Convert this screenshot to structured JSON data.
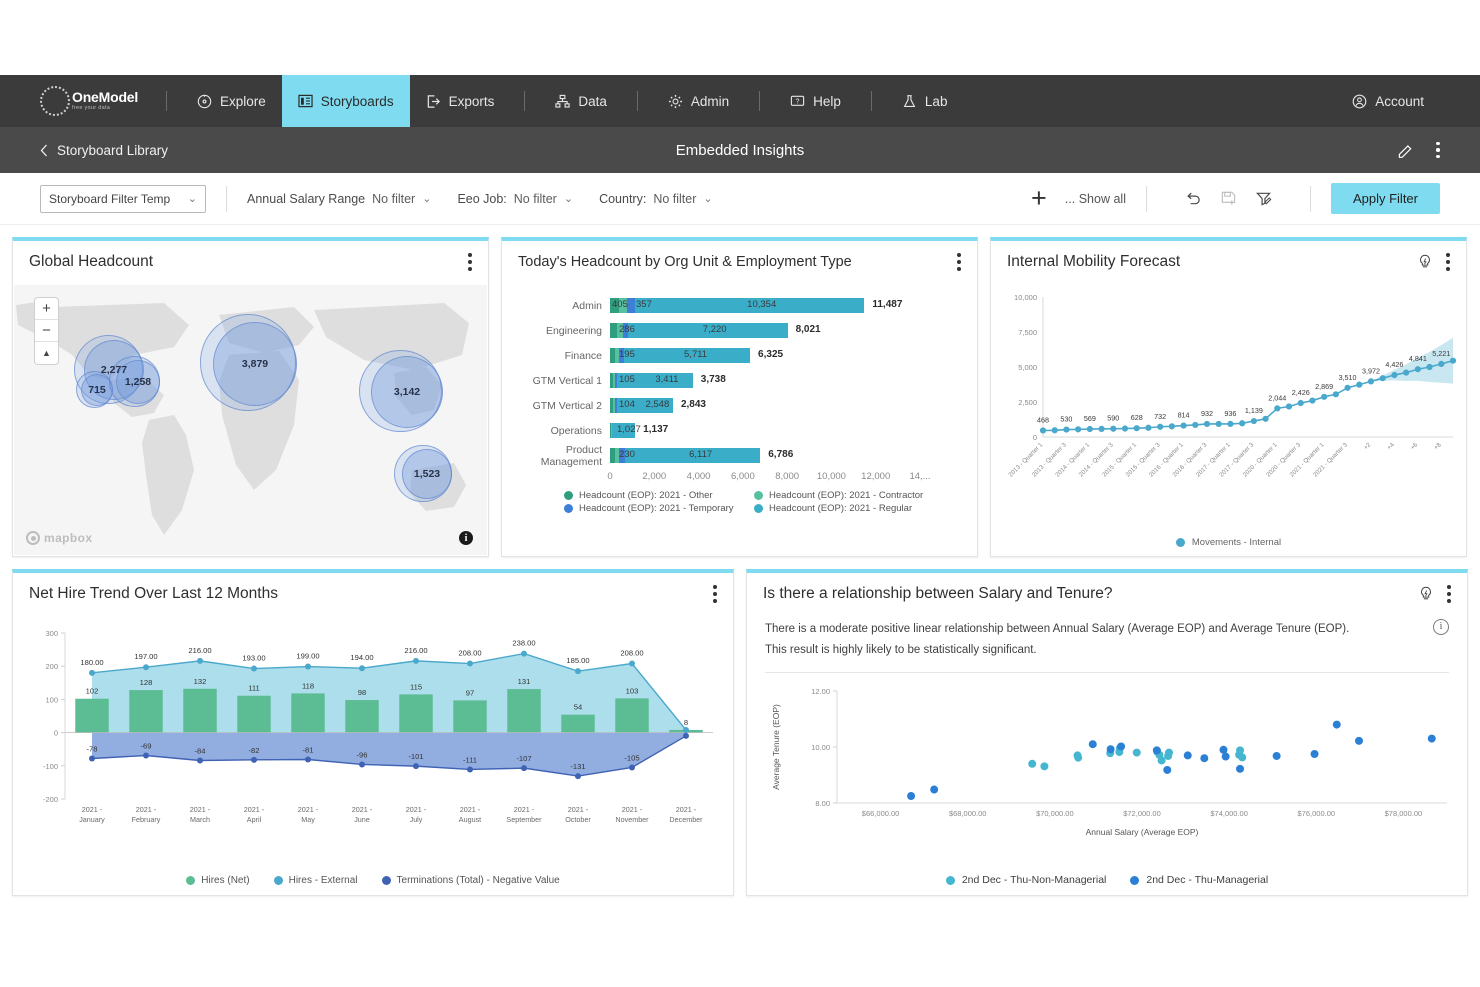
{
  "nav": {
    "logo_name": "OneModel",
    "logo_tagline": "free your data",
    "items": [
      {
        "label": "Explore",
        "icon": "compass-icon",
        "active": false
      },
      {
        "label": "Storyboards",
        "icon": "storyboard-icon",
        "active": true
      },
      {
        "label": "Exports",
        "icon": "export-icon",
        "active": false
      },
      {
        "label": "Data",
        "icon": "data-icon",
        "active": false
      },
      {
        "label": "Admin",
        "icon": "gear-icon",
        "active": false
      },
      {
        "label": "Help",
        "icon": "help-icon",
        "active": false
      },
      {
        "label": "Lab",
        "icon": "flask-icon",
        "active": false
      }
    ],
    "account_label": "Account",
    "active_color": "#7fdbf0"
  },
  "subheader": {
    "back_label": "Storyboard Library",
    "title": "Embedded Insights",
    "edit_icon": "pencil-icon",
    "more_icon": "kebab-menu-icon"
  },
  "filterbar": {
    "template_value": "Storyboard Filter Temp",
    "filters": [
      {
        "name": "Annual Salary Range",
        "value": "No filter"
      },
      {
        "name": "Eeo Job:",
        "value": "No filter"
      },
      {
        "name": "Country:",
        "value": "No filter"
      }
    ],
    "add_icon": "plus-icon",
    "show_all_label": "... Show all",
    "reset_icon": "undo-icon",
    "save_icon": "save-icon",
    "edit_filter_icon": "filter-edit-icon",
    "apply_label": "Apply Filter"
  },
  "panels": {
    "map": {
      "title": "Global Headcount",
      "more_icon": "kebab-menu-icon",
      "attribution": "mapbox",
      "zoom_in": "+",
      "zoom_out": "−",
      "compass": "compass-icon",
      "info_icon": "info-icon"
    },
    "bar": {
      "title": "Today's Headcount by Org Unit & Employment Type",
      "more_icon": "kebab-menu-icon"
    },
    "mobility": {
      "title": "Internal Mobility Forecast",
      "insight_icon": "lightbulb-icon",
      "more_icon": "kebab-menu-icon"
    },
    "net": {
      "title": "Net Hire Trend Over Last 12 Months",
      "more_icon": "kebab-menu-icon"
    },
    "scatter": {
      "title": "Is there a relationship between Salary and Tenure?",
      "insight_icon": "lightbulb-icon",
      "more_icon": "kebab-menu-icon",
      "info_icon": "info-icon",
      "insight_line1": "There is a moderate positive linear relationship between Annual Salary (Average EOP) and Average Tenure (EOP).",
      "insight_line2": "This result is highly likely to be statistically significant."
    }
  },
  "chart_data": [
    {
      "id": "global_headcount_map",
      "type": "scatter",
      "title": "Global Headcount",
      "bubbles": [
        {
          "label": "2,277",
          "value": 2277,
          "cx": 100,
          "cy": 85,
          "r": 30
        },
        {
          "label": "715",
          "value": 715,
          "cx": 83,
          "cy": 105,
          "r": 16
        },
        {
          "label": "1,258",
          "value": 1258,
          "cx": 124,
          "cy": 97,
          "r": 22
        },
        {
          "label": "3,879",
          "value": 3879,
          "cx": 241,
          "cy": 79,
          "r": 42
        },
        {
          "label": "3,142",
          "value": 3142,
          "cx": 393,
          "cy": 107,
          "r": 36
        },
        {
          "label": "1,523",
          "value": 1523,
          "cx": 413,
          "cy": 189,
          "r": 25
        }
      ]
    },
    {
      "id": "headcount_by_org_unit",
      "type": "bar",
      "orientation": "horizontal",
      "stacked": true,
      "title": "Today's Headcount by Org Unit & Employment Type",
      "categories": [
        "Admin",
        "Engineering",
        "Finance",
        "GTM Vertical 1",
        "GTM Vertical 2",
        "Operations",
        "Product Management"
      ],
      "series": [
        {
          "name": "Headcount (EOP): 2021 - Other",
          "color": "#2e9e7e",
          "values": [
            405,
            300,
            220,
            120,
            120,
            60,
            230
          ]
        },
        {
          "name": "Headcount (EOP): 2021 - Contractor",
          "color": "#56c0a0",
          "values": [
            357,
            286,
            195,
            105,
            104,
            50,
            180
          ]
        },
        {
          "name": "Headcount (EOP): 2021 - Temporary",
          "color": "#3d7fd6",
          "values": [
            371,
            215,
            199,
            102,
            71,
            0,
            259
          ]
        },
        {
          "name": "Headcount (EOP): 2021 - Regular",
          "color": "#3aaec9",
          "values": [
            10354,
            7220,
            5711,
            3411,
            2548,
            1027,
            6117
          ]
        }
      ],
      "labeled_segments": [
        {
          "category": "Admin",
          "labels": [
            "405",
            "357",
            "10,354"
          ],
          "total": "11,487"
        },
        {
          "category": "Engineering",
          "labels": [
            "286",
            "7,220"
          ],
          "total": "8,021"
        },
        {
          "category": "Finance",
          "labels": [
            "195",
            "5,711"
          ],
          "total": "6,325"
        },
        {
          "category": "GTM Vertical 1",
          "labels": [
            "105",
            "3,411"
          ],
          "total": "3,738"
        },
        {
          "category": "GTM Vertical 2",
          "labels": [
            "104",
            "2,548"
          ],
          "total": "2,843"
        },
        {
          "category": "Operations",
          "labels": [
            "1,027"
          ],
          "total": "1,137"
        },
        {
          "category": "Product Management",
          "labels": [
            "230",
            "6,117"
          ],
          "total": "6,786"
        }
      ],
      "totals": [
        11487,
        8021,
        6325,
        3738,
        2843,
        1137,
        6786
      ],
      "xticks": [
        "0",
        "2,000",
        "4,000",
        "6,000",
        "8,000",
        "10,000",
        "12,000",
        "14,..."
      ],
      "xlim": [
        0,
        14000
      ]
    },
    {
      "id": "internal_mobility_forecast",
      "type": "line",
      "title": "Internal Mobility Forecast",
      "legend": "Movements - Internal",
      "legend_position": "bottom",
      "ylabel": "",
      "xlabel": "",
      "ylim": [
        0,
        10000
      ],
      "yticks": [
        "0",
        "2,500",
        "5,000",
        "7,500",
        "10,000"
      ],
      "color": "#4aa8cc",
      "band_color": "#bfe3ef",
      "x": [
        "2013 - Quarter 1",
        "2013 - Quarter 2",
        "2013 - Quarter 3",
        "2013 - Quarter 4",
        "2014 - Quarter 1",
        "2014 - Quarter 2",
        "2014 - Quarter 3",
        "2014 - Quarter 4",
        "2015 - Quarter 1",
        "2015 - Quarter 2",
        "2015 - Quarter 3",
        "2015 - Quarter 4",
        "2016 - Quarter 1",
        "2016 - Quarter 2",
        "2016 - Quarter 3",
        "2016 - Quarter 4",
        "2017 - Quarter 1",
        "2017 - Quarter 2",
        "2017 - Quarter 3",
        "2017 - Quarter 4",
        "2020 - Quarter 1",
        "2020 - Quarter 2",
        "2020 - Quarter 3",
        "2020 - Quarter 4",
        "2021 - Quarter 1",
        "2021 - Quarter 2",
        "2021 - Quarter 3",
        "2021 - Quarter 4",
        "+2",
        "+3",
        "+4",
        "+5",
        "+6",
        "+7",
        "+8",
        "+9"
      ],
      "xtick_labels": [
        "2013 - Quarter 1",
        "2013 - Quarter 3",
        "2014 - Quarter 1",
        "2014 - Quarter 3",
        "2015 - Quarter 1",
        "2015 - Quarter 3",
        "2016 - Quarter 1",
        "2016 - Quarter 3",
        "2017 - Quarter 1",
        "2017 - Quarter 3",
        "2020 - Quarter 1",
        "2020 - Quarter 3",
        "2021 - Quarter 1",
        "2021 - Quarter 3",
        "+2",
        "+4",
        "+6",
        "+8"
      ],
      "values": [
        468,
        480,
        530,
        545,
        569,
        578,
        590,
        605,
        628,
        660,
        732,
        760,
        814,
        860,
        932,
        934,
        936,
        980,
        1139,
        1300,
        2044,
        2180,
        2426,
        2600,
        2869,
        3050,
        3510,
        3740,
        3972,
        4200,
        4426,
        4600,
        4841,
        5000,
        5221,
        5450
      ],
      "point_labels": [
        "468",
        "530",
        "569",
        "590",
        "628",
        "732",
        "814",
        "932",
        "936",
        "1,139",
        "2,044",
        "2,426",
        "2,869",
        "3,510",
        "3,972",
        "4,426",
        "4,841",
        "5,221"
      ],
      "forecast_start_index": 28
    },
    {
      "id": "net_hire_trend",
      "type": "bar",
      "title": "Net Hire Trend Over Last 12 Months",
      "categories": [
        "2021 - January",
        "2021 - February",
        "2021 - March",
        "2021 - April",
        "2021 - May",
        "2021 - June",
        "2021 - July",
        "2021 - August",
        "2021 - September",
        "2021 - October",
        "2021 - November",
        "2021 - December"
      ],
      "ylim": [
        -200,
        300
      ],
      "yticks": [
        "-200",
        "-100",
        "0",
        "100",
        "200",
        "300"
      ],
      "series": [
        {
          "name": "Hires (Net)",
          "type": "bar",
          "color": "#5cbc93",
          "values": [
            102,
            128,
            132,
            111,
            118,
            98,
            115,
            97,
            131,
            54,
            103,
            8
          ],
          "labels": [
            "102",
            "128",
            "132",
            "111",
            "118",
            "98",
            "115",
            "97",
            "131",
            "54",
            "103",
            "8"
          ]
        },
        {
          "name": "Hires - External",
          "type": "area",
          "color": "#4aa8cc",
          "fill": "#a9dcea",
          "values": [
            180,
            197,
            216,
            193,
            199,
            194,
            216,
            208,
            238,
            185,
            208,
            8
          ],
          "labels": [
            "180.00",
            "197.00",
            "216.00",
            "193.00",
            "199.00",
            "194.00",
            "216.00",
            "208.00",
            "238.00",
            "185.00",
            "208.00",
            ""
          ]
        },
        {
          "name": "Terminations (Total) - Negative Value",
          "type": "area",
          "color": "#3f62b5",
          "fill": "#8fa9e0",
          "values": [
            -78,
            -69,
            -84,
            -82,
            -81,
            -96,
            -101,
            -111,
            -107,
            -131,
            -105,
            -10
          ],
          "labels": [
            "-78",
            "-69",
            "-84",
            "-82",
            "-81",
            "-96",
            "-101",
            "-111",
            "-107",
            "-131",
            "-105",
            ""
          ]
        }
      ]
    },
    {
      "id": "salary_tenure_scatter",
      "type": "scatter",
      "title": "Is there a relationship between Salary and Tenure?",
      "xlabel": "Annual Salary (Average EOP)",
      "ylabel": "Average Tenure (EOP)",
      "xlim": [
        65000,
        79000
      ],
      "ylim": [
        8.0,
        12.0
      ],
      "xticks": [
        "$66,000.00",
        "$68,000.00",
        "$70,000.00",
        "$72,000.00",
        "$74,000.00",
        "$76,000.00",
        "$78,000.00"
      ],
      "yticks": [
        "8.00",
        "10.00",
        "12.00"
      ],
      "series": [
        {
          "name": "2nd Dec - Thu-Non-Managerial",
          "color": "#45b6cf",
          "points": [
            [
              70535,
              9.62
            ],
            [
              70520,
              9.7
            ],
            [
              71270,
              9.78
            ],
            [
              71480,
              9.82
            ],
            [
              71490,
              9.95
            ],
            [
              71880,
              9.8
            ],
            [
              72350,
              9.83
            ],
            [
              72400,
              9.72
            ],
            [
              72450,
              9.52
            ],
            [
              72600,
              9.68
            ],
            [
              72620,
              9.8
            ],
            [
              74230,
              9.72
            ],
            [
              74250,
              9.88
            ],
            [
              74300,
              9.63
            ],
            [
              69480,
              9.4
            ],
            [
              69760,
              9.31
            ]
          ]
        },
        {
          "name": "2nd Dec - Thu-Managerial",
          "color": "#2b7fd4",
          "points": [
            [
              66700,
              8.25
            ],
            [
              67230,
              8.48
            ],
            [
              70870,
              10.1
            ],
            [
              71280,
              9.92
            ],
            [
              71520,
              10.02
            ],
            [
              72340,
              9.88
            ],
            [
              73050,
              9.7
            ],
            [
              73430,
              9.6
            ],
            [
              73870,
              9.9
            ],
            [
              73920,
              9.66
            ],
            [
              72580,
              9.18
            ],
            [
              74250,
              9.22
            ],
            [
              75090,
              9.68
            ],
            [
              75960,
              9.75
            ],
            [
              76470,
              10.8
            ],
            [
              76980,
              10.22
            ],
            [
              78650,
              10.3
            ]
          ]
        }
      ]
    }
  ]
}
